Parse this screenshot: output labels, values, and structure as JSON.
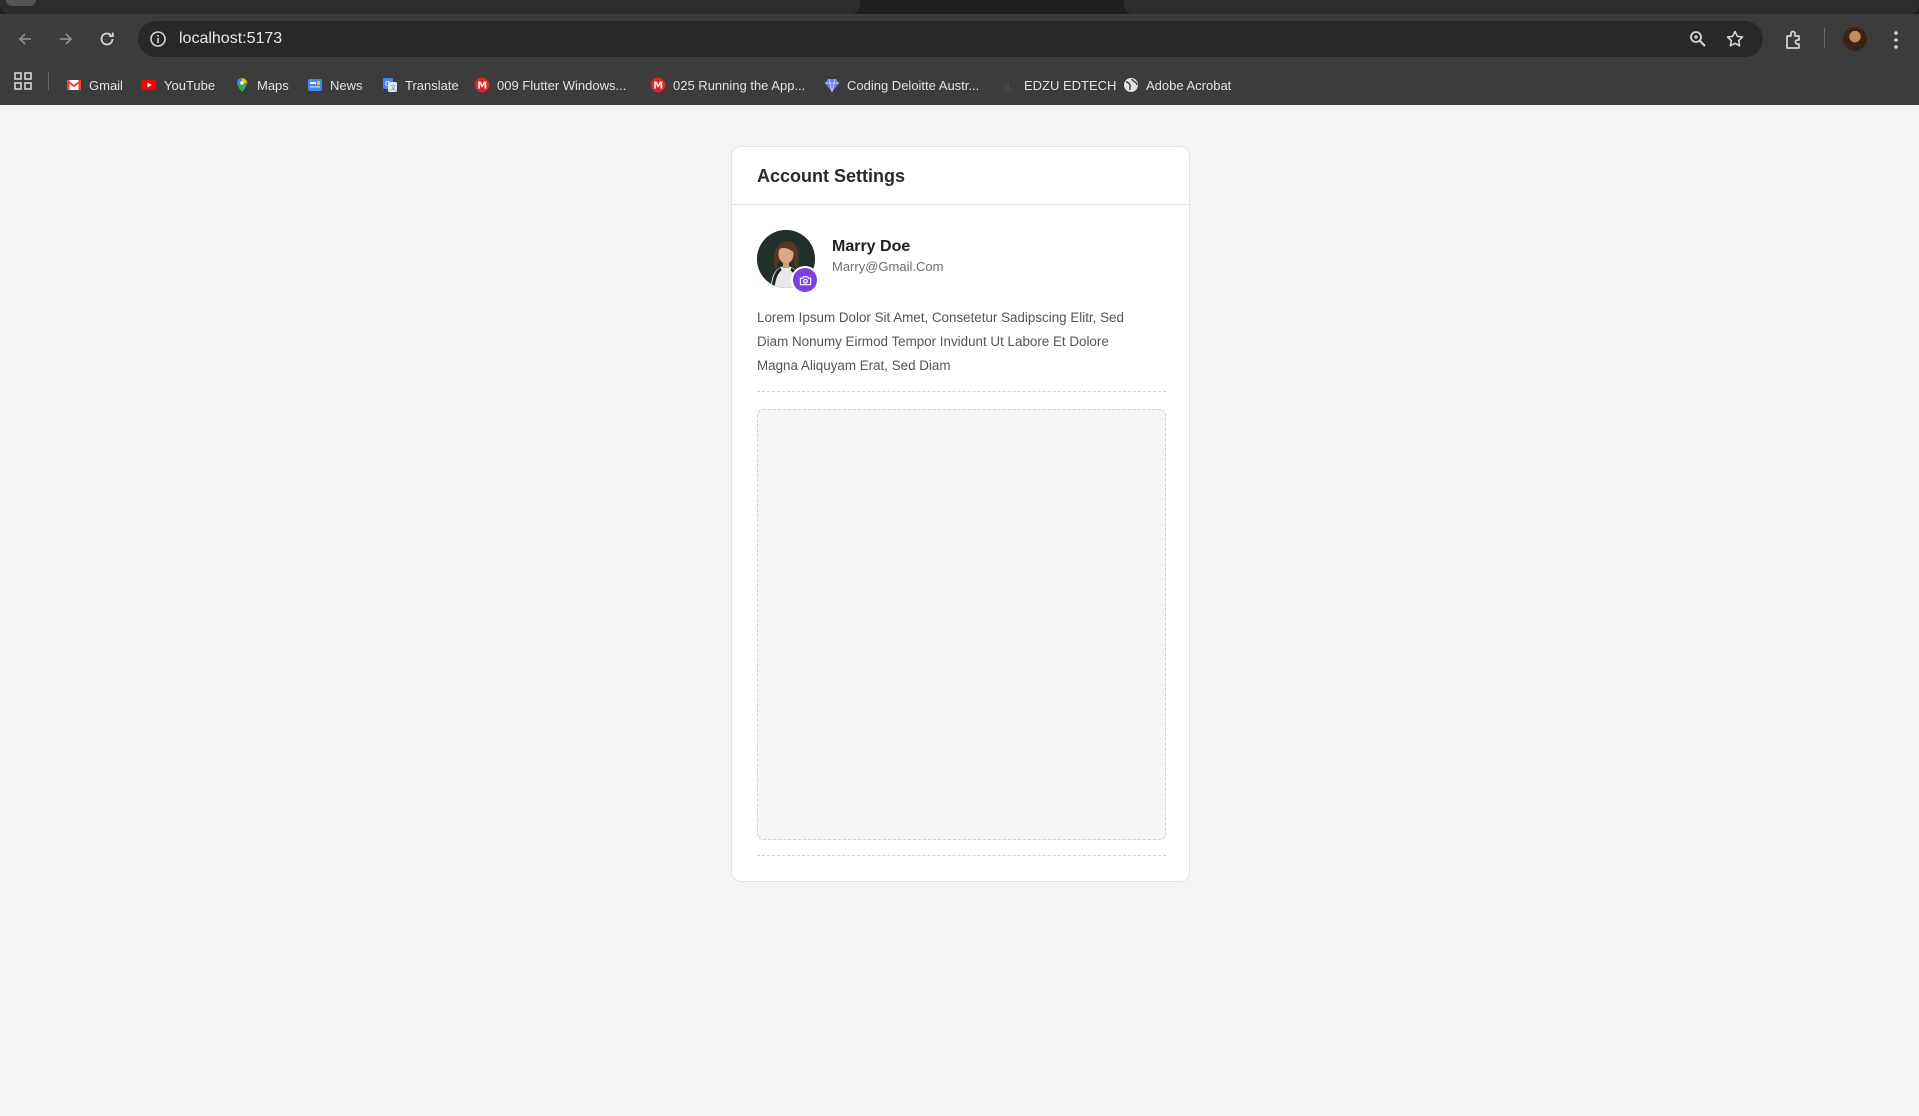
{
  "browser": {
    "url": "localhost:5173",
    "bookmarks": [
      {
        "label": "Gmail",
        "icon": "gmail-icon",
        "color": "#ea4335"
      },
      {
        "label": "YouTube",
        "icon": "youtube-icon",
        "color": "#ff0000"
      },
      {
        "label": "Maps",
        "icon": "maps-icon",
        "color": "#34a853"
      },
      {
        "label": "News",
        "icon": "news-icon",
        "color": "#4285f4"
      },
      {
        "label": "Translate",
        "icon": "translate-icon",
        "color": "#4285f4"
      },
      {
        "label": "009 Flutter Windows...",
        "icon": "m-icon",
        "color": "#e02424"
      },
      {
        "label": "025 Running the App...",
        "icon": "m-icon",
        "color": "#e02424"
      },
      {
        "label": "Coding Deloitte Austr...",
        "icon": "diamond-icon",
        "color": "#6f7cf0"
      },
      {
        "label": "EDZU EDTECH",
        "icon": "edzu-icon",
        "color": "#5a5a5a"
      },
      {
        "label": "Adobe Acrobat",
        "icon": "globe-icon",
        "color": "#e3e3e3"
      }
    ]
  },
  "page": {
    "title": "Account Settings",
    "user": {
      "name": "Marry Doe",
      "email": "Marry@Gmail.Com"
    },
    "bio": "Lorem Ipsum Dolor Sit Amet, Consetetur Sadipscing Elitr, Sed Diam Nonumy Eirmod Tempor Invidunt Ut Labore Et Dolore Magna Aliquyam Erat, Sed Diam",
    "accent_color": "#7b3fe4"
  }
}
